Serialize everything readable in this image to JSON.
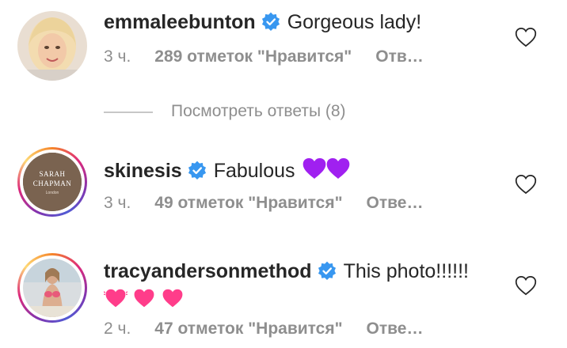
{
  "comments": [
    {
      "username": "emmaleebunton",
      "text": "Gorgeous lady!",
      "time": "3 ч.",
      "likes": "289 отметок \"Нравится\"",
      "reply": "Отв…"
    },
    {
      "username": "skinesis",
      "text": "Fabulous",
      "time": "3 ч.",
      "likes": "49 отметок \"Нравится\"",
      "reply": "Отве…",
      "avatar_text": {
        "line1": "SARAH",
        "line2": "CHAPMAN",
        "line3": "London"
      }
    },
    {
      "username": "tracyandersonmethod",
      "text": "This photo!!!!!!",
      "time": "2 ч.",
      "likes": "47 отметок \"Нравится\"",
      "reply": "Отве…"
    }
  ],
  "view_replies": "Посмотреть ответы (8)",
  "colors": {
    "verified": "#3897f0",
    "meta_text": "#8e8e8e",
    "purple_heart": "#a020f0",
    "pink_heart": "#ff3d8a"
  },
  "icons": [
    "verified-badge-icon",
    "heart-outline-icon",
    "purple-heart-emoji",
    "pink-heart-emoji"
  ]
}
